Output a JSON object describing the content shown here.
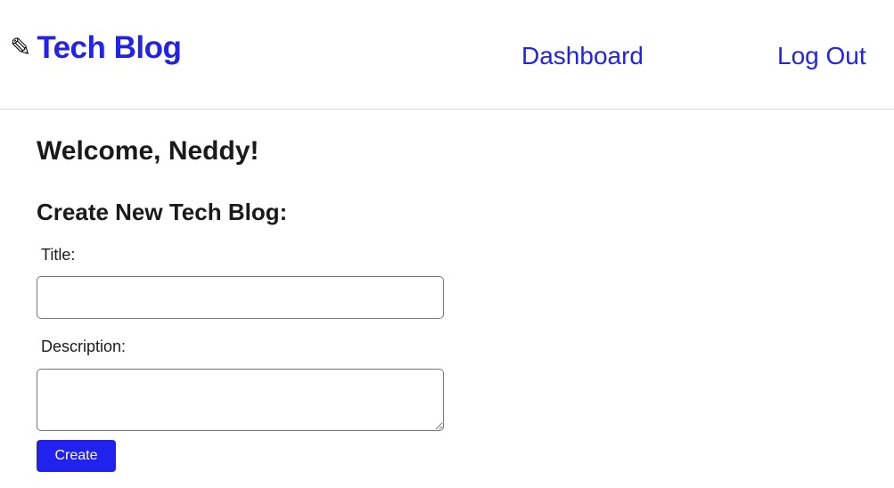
{
  "header": {
    "brand_icon": "pencil-icon",
    "brand_icon_glyph": "✎",
    "brand_title": "Tech Blog",
    "nav": {
      "dashboard_label": "Dashboard",
      "logout_label": "Log Out"
    }
  },
  "main": {
    "welcome": "Welcome, Neddy!",
    "form": {
      "heading": "Create New Tech Blog:",
      "title_label": "Title:",
      "title_value": "",
      "description_label": "Description:",
      "description_value": "",
      "submit_label": "Create"
    }
  },
  "colors": {
    "accent": "#2222ee",
    "text": "#1a1a1a",
    "divider": "#d7d7d7"
  }
}
